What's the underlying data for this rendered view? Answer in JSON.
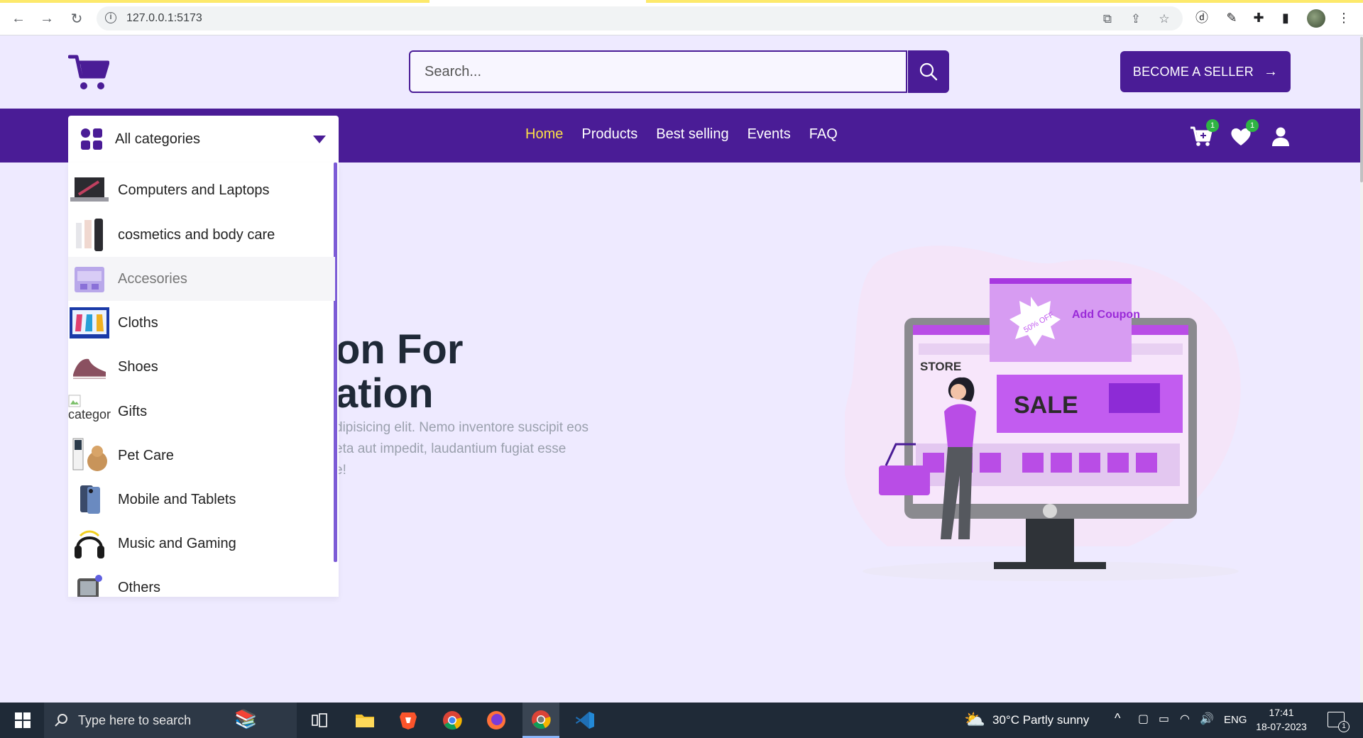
{
  "browser": {
    "url": "127.0.0.1:5173",
    "back_icon": "arrow-left-icon",
    "forward_icon": "arrow-right-icon",
    "reload_icon": "reload-icon"
  },
  "header": {
    "logo_icon": "shopping-cart-icon",
    "search": {
      "placeholder": "Search..."
    },
    "search_icon": "magnifier-icon",
    "seller_button": "BECOME A SELLER",
    "brand_color": "#4a1c96"
  },
  "navbar": {
    "categories_label": "All categories",
    "links": [
      "Home",
      "Products",
      "Best selling",
      "Events",
      "FAQ"
    ],
    "active_link": "Home",
    "cart_count": "1",
    "wishlist_count": "1"
  },
  "categories": [
    "Computers and Laptops",
    "cosmetics and body care",
    "Accesories",
    "Cloths",
    "Shoes",
    "Gifts",
    "Pet Care",
    "Mobile and Tablets",
    "Music and Gaming",
    "Others"
  ],
  "broken_image_alt": "categories",
  "hero": {
    "title_line1": "on For",
    "title_line2": "ation",
    "desc_line1": "dipisicing elit. Nemo inventore suscipit eos",
    "desc_line2": "eta aut impedit, laudantium fugiat esse",
    "desc_line3": "e!",
    "illus_coupon_pct": "50% OFF",
    "illus_coupon_text": "Add Coupon",
    "illus_store": "STORE",
    "illus_sale": "SALE"
  },
  "taskbar": {
    "search_label": "Type here to search",
    "weather": "30°C  Partly sunny",
    "language": "ENG",
    "time": "17:41",
    "date": "18-07-2023",
    "notification_count": "1"
  }
}
